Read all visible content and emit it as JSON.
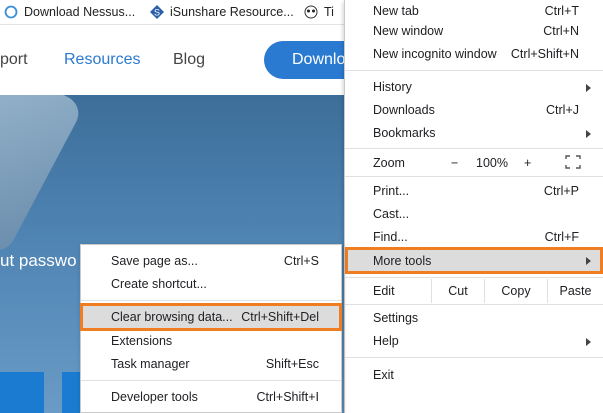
{
  "bookmarks": [
    {
      "icon": "globe-icon",
      "label": "Download Nessus..."
    },
    {
      "icon": "isunshare-logo-icon",
      "label": "iSunshare Resource..."
    },
    {
      "icon": "panda-icon",
      "label": "Ti"
    }
  ],
  "site": {
    "nav": [
      "port",
      "Resources",
      "Blog"
    ],
    "download_label": "Downlo",
    "hero_text": "ut passwo"
  },
  "menu": {
    "new_tab": {
      "label": "New tab",
      "shortcut": "Ctrl+T"
    },
    "new_window": {
      "label": "New window",
      "shortcut": "Ctrl+N"
    },
    "new_incognito": {
      "label": "New incognito window",
      "shortcut": "Ctrl+Shift+N"
    },
    "history": {
      "label": "History"
    },
    "downloads": {
      "label": "Downloads",
      "shortcut": "Ctrl+J"
    },
    "bookmarks": {
      "label": "Bookmarks"
    },
    "zoom": {
      "label": "Zoom",
      "minus": "−",
      "value": "100%",
      "plus": "+"
    },
    "print": {
      "label": "Print...",
      "shortcut": "Ctrl+P"
    },
    "cast": {
      "label": "Cast..."
    },
    "find": {
      "label": "Find...",
      "shortcut": "Ctrl+F"
    },
    "more_tools": {
      "label": "More tools"
    },
    "edit": {
      "label": "Edit",
      "cut": "Cut",
      "copy": "Copy",
      "paste": "Paste"
    },
    "settings": {
      "label": "Settings"
    },
    "help": {
      "label": "Help"
    },
    "exit": {
      "label": "Exit"
    }
  },
  "submenu": {
    "save_page": {
      "label": "Save page as...",
      "shortcut": "Ctrl+S"
    },
    "create_shortcut": {
      "label": "Create shortcut..."
    },
    "clear_browsing": {
      "label": "Clear browsing data...",
      "shortcut": "Ctrl+Shift+Del"
    },
    "extensions": {
      "label": "Extensions"
    },
    "task_manager": {
      "label": "Task manager",
      "shortcut": "Shift+Esc"
    },
    "developer_tools": {
      "label": "Developer tools",
      "shortcut": "Ctrl+Shift+I"
    }
  },
  "colors": {
    "highlight_border": "#ef7d21",
    "brand_blue": "#2a7ad1"
  }
}
